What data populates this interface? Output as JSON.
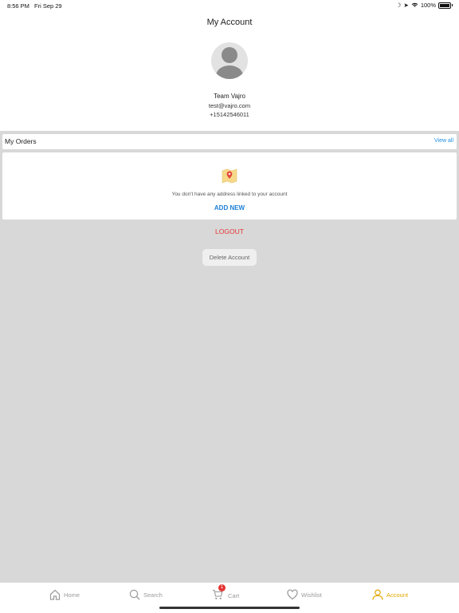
{
  "status_bar": {
    "time": "8:56 PM",
    "date": "Fri Sep 29",
    "battery": "100%"
  },
  "header": {
    "title": "My Account"
  },
  "profile": {
    "name": "Team Vajro",
    "email": "test@vajro.com",
    "phone": "+15142546011"
  },
  "orders": {
    "title": "My Orders",
    "view_all_label": "View all"
  },
  "address": {
    "empty_message": "You don't have any address linked to your account",
    "add_new_label": "ADD NEW"
  },
  "actions": {
    "logout_label": "LOGOUT",
    "delete_account_label": "Delete Account"
  },
  "tabs": [
    {
      "label": "Home",
      "icon": "home-icon"
    },
    {
      "label": "Search",
      "icon": "search-icon"
    },
    {
      "label": "Cart",
      "icon": "cart-icon",
      "badge": "1"
    },
    {
      "label": "Wishlist",
      "icon": "heart-icon"
    },
    {
      "label": "Account",
      "icon": "user-icon",
      "active": true
    }
  ],
  "colors": {
    "accent": "#e0a800",
    "link": "#1e7fd8",
    "danger": "#e53333",
    "background": "#d8d8d8"
  }
}
